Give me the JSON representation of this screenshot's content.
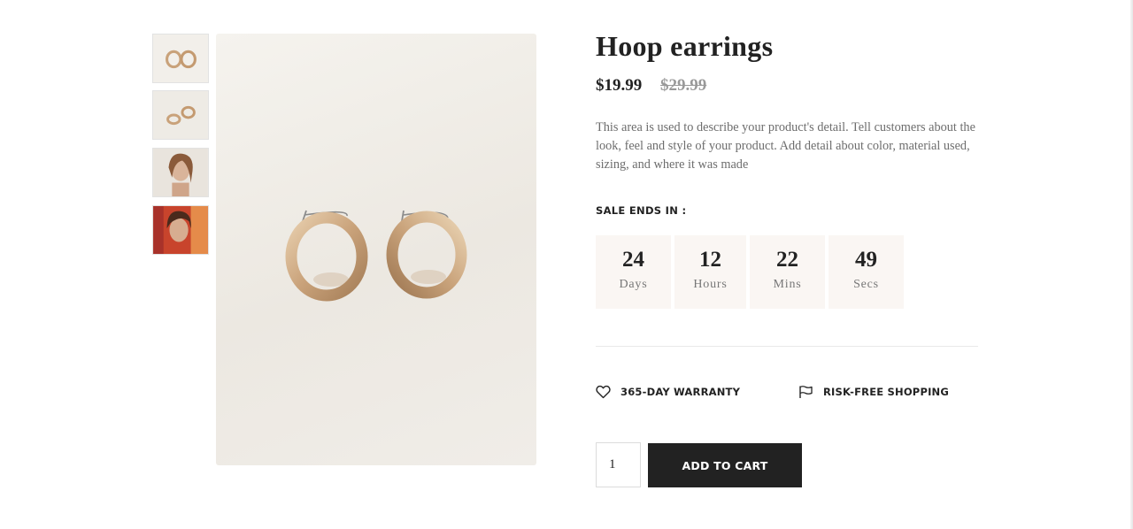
{
  "gallery": {
    "thumbnails": [
      {
        "subject": "hoop earrings pair top view"
      },
      {
        "subject": "hoop earrings pair angled"
      },
      {
        "subject": "model portrait"
      },
      {
        "subject": "model wearing earrings"
      }
    ],
    "main_image": {
      "subject": "gold hoop earrings"
    }
  },
  "product": {
    "title": "Hoop earrings",
    "price": "$19.99",
    "compare_price": "$29.99",
    "description": "This area is used to describe your product's detail. Tell customers about the look, feel and style of your product. Add detail about color, material used, sizing, and where it was made"
  },
  "countdown": {
    "label": "SALE ENDS IN :",
    "items": [
      {
        "value": "24",
        "unit": "Days"
      },
      {
        "value": "12",
        "unit": "Hours"
      },
      {
        "value": "22",
        "unit": "Mins"
      },
      {
        "value": "49",
        "unit": "Secs"
      }
    ]
  },
  "features": [
    {
      "icon": "heart-icon",
      "label": "365-DAY WARRANTY"
    },
    {
      "icon": "flag-icon",
      "label": "RISK-FREE SHOPPING"
    }
  ],
  "cart": {
    "quantity": "1",
    "add_label": "ADD TO CART"
  },
  "colors": {
    "button_bg": "#222222",
    "countdown_bg": "#faf6f3",
    "compare_price": "#999999",
    "gold": "#c9a27a"
  }
}
